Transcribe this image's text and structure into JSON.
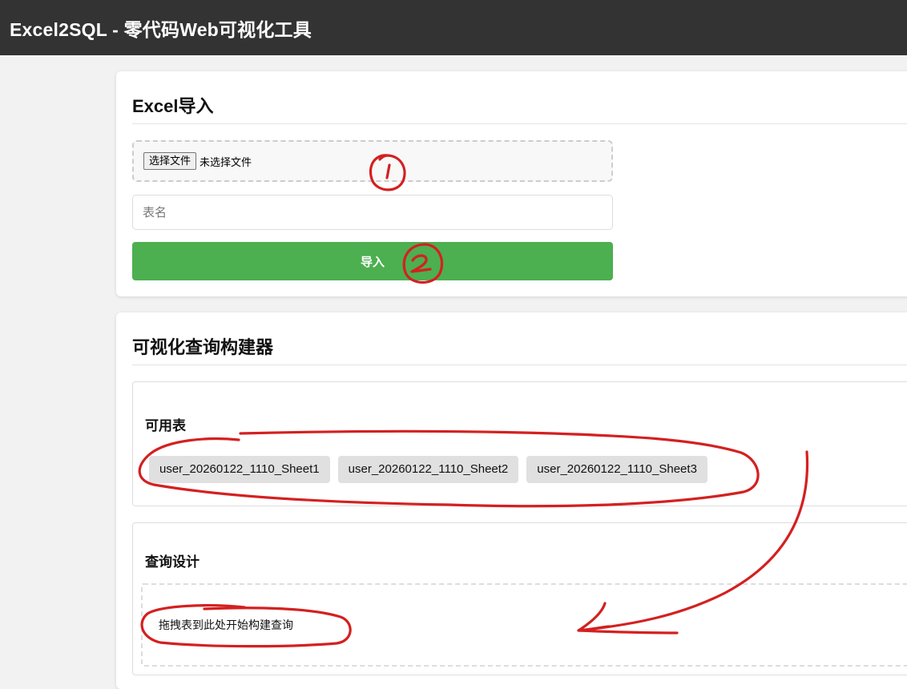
{
  "header": {
    "title": "Excel2SQL - 零代码Web可视化工具"
  },
  "import_section": {
    "title": "Excel导入",
    "file_button_label": "选择文件",
    "file_status": "未选择文件",
    "table_name_placeholder": "表名",
    "import_button_label": "导入"
  },
  "query_builder": {
    "title": "可视化查询构建器",
    "available_tables": {
      "title": "可用表",
      "tables": [
        "user_20260122_1110_Sheet1",
        "user_20260122_1110_Sheet2",
        "user_20260122_1110_Sheet3"
      ]
    },
    "query_design": {
      "title": "查询设计",
      "drop_hint": "拖拽表到此处开始构建查询"
    }
  },
  "colors": {
    "header_bg": "#333333",
    "page_bg": "#f2f2f2",
    "primary_button": "#4caf50",
    "annotation_ink": "#d42020"
  },
  "icons": [
    "dropdown-arrow-annotation"
  ]
}
